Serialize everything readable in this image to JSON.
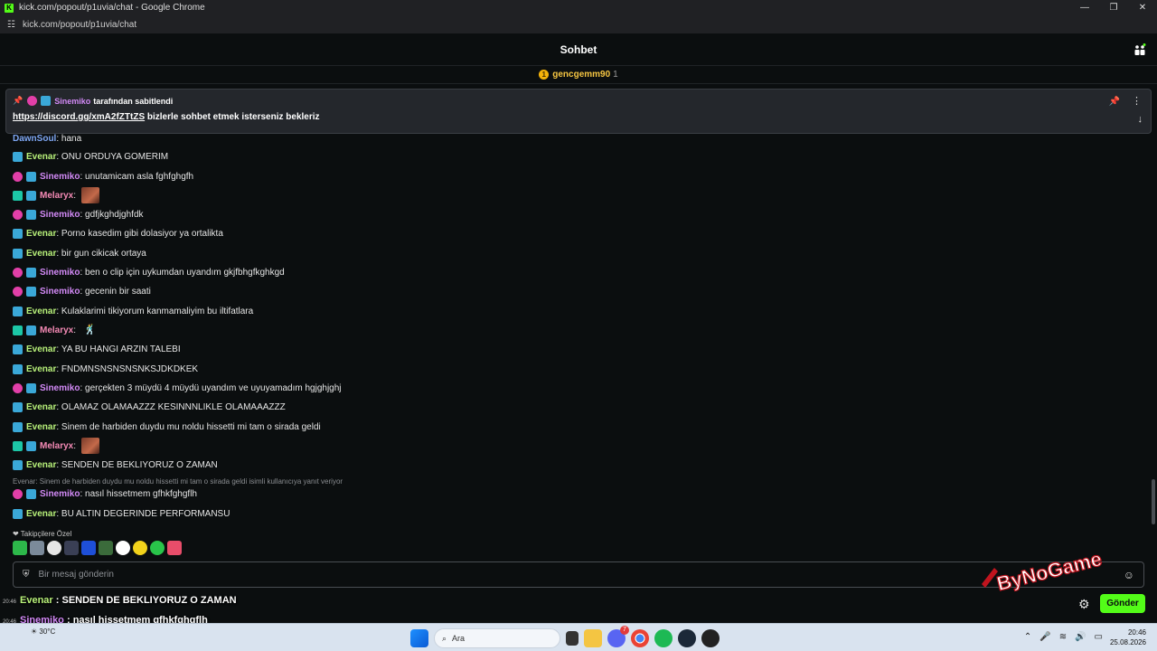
{
  "window": {
    "title": "kick.com/popout/p1uvia/chat - Google Chrome",
    "url": "kick.com/popout/p1uvia/chat",
    "controls": {
      "minimize": "—",
      "restore": "❐",
      "close": "✕"
    }
  },
  "header": {
    "title": "Sohbet"
  },
  "gifter": {
    "name": "gencgemm90",
    "count": "1",
    "coin_glyph": "1"
  },
  "pinned": {
    "by_user": "Sinemiko",
    "by_text": "tarafından sabitlendi",
    "link": "https://discord.gg/xmA2fZTtZS",
    "text": " bizlerle sohbet etmek isterseniz bekleriz"
  },
  "colors": {
    "kick_green": "#53fc18",
    "evenar": "#b8f17a",
    "sinemiko": "#d38af7",
    "melaryx": "#f58ab5",
    "dawnsoul": "#7ea6f2",
    "background": "#0b0e0f"
  },
  "messages": [
    {
      "user": "DawnSoul",
      "text": "hana",
      "badges": [],
      "color": "#7ea6f2"
    },
    {
      "user": "Evenar",
      "text": "ONU ORDUYA GOMERIM",
      "badges": [
        "vip"
      ],
      "color": "#b8f17a"
    },
    {
      "user": "Sinemiko",
      "text": "unutamicam asla fghfghgfh",
      "badges": [
        "og",
        "vip"
      ],
      "color": "#d38af7"
    },
    {
      "user": "Melaryx",
      "text": "",
      "badges": [
        "sub",
        "vip"
      ],
      "color": "#f58ab5",
      "emote": "photo-emote"
    },
    {
      "user": "Sinemiko",
      "text": "gdfjkghdjghfdk",
      "badges": [
        "og",
        "vip"
      ],
      "color": "#d38af7"
    },
    {
      "user": "Evenar",
      "text": "Porno kasedim gibi dolasiyor ya ortalikta",
      "badges": [
        "vip"
      ],
      "color": "#b8f17a"
    },
    {
      "user": "Evenar",
      "text": "bir gun cikicak ortaya",
      "badges": [
        "vip"
      ],
      "color": "#b8f17a"
    },
    {
      "user": "Sinemiko",
      "text": "ben o clip için uykumdan uyandım gkjfbhgfkghkgd",
      "badges": [
        "og",
        "vip"
      ],
      "color": "#d38af7"
    },
    {
      "user": "Sinemiko",
      "text": "gecenin bir saati",
      "badges": [
        "og",
        "vip"
      ],
      "color": "#d38af7"
    },
    {
      "user": "Evenar",
      "text": "Kulaklarimi tikiyorum kanmamaliyim bu iltifatlara",
      "badges": [
        "vip"
      ],
      "color": "#b8f17a"
    },
    {
      "user": "Melaryx",
      "text": "",
      "badges": [
        "sub",
        "vip"
      ],
      "color": "#f58ab5",
      "emote": "dancing-emote"
    },
    {
      "user": "Evenar",
      "text": "YA BU HANGI ARZIN TALEBI",
      "badges": [
        "vip"
      ],
      "color": "#b8f17a"
    },
    {
      "user": "Evenar",
      "text": "FNDMNSNSNSNSNKSJDKDKEK",
      "badges": [
        "vip"
      ],
      "color": "#b8f17a"
    },
    {
      "user": "Sinemiko",
      "text": "gerçekten 3 müydü 4 müydü uyandım ve uyuyamadım hgjghjghj",
      "badges": [
        "og",
        "vip"
      ],
      "color": "#d38af7"
    },
    {
      "user": "Evenar",
      "text": "OLAMAZ OLAMAAZZZ KESINNNLIKLE OLAMAAAZZZ",
      "badges": [
        "vip"
      ],
      "color": "#b8f17a"
    },
    {
      "user": "Evenar",
      "text": "Sinem de harbiden duydu mu noldu hissetti mi tam o sirada geldi",
      "badges": [
        "vip"
      ],
      "color": "#b8f17a"
    },
    {
      "user": "Melaryx",
      "text": "",
      "badges": [
        "sub",
        "vip"
      ],
      "color": "#f58ab5",
      "emote": "photo-emote"
    },
    {
      "user": "Evenar",
      "text": "SENDEN DE BEKLIYORUZ O ZAMAN",
      "badges": [
        "vip"
      ],
      "color": "#b8f17a"
    },
    {
      "user": "Sinemiko",
      "text": "nasıl hissetmem gfhkfghgflh",
      "badges": [
        "og",
        "vip"
      ],
      "color": "#d38af7"
    },
    {
      "user": "Evenar",
      "text": "BU ALTIN DEGERINDE PERFORMANSU",
      "badges": [
        "vip"
      ],
      "color": "#b8f17a"
    }
  ],
  "reply_note": "Evenar: Sinem de harbiden duydu mu noldu hissetti mi tam o sirada geldi isimli kullanıcıya yanıt veriyor",
  "followers_label": "Takipçilere Özel",
  "input": {
    "placeholder": "Bir mesaj gönderin"
  },
  "send_button": "Gönder",
  "watermark": "ByNoGame",
  "overlay": [
    {
      "time": "20:46",
      "user": "Evenar",
      "text": "SENDEN DE BEKLIYORUZ O ZAMAN"
    },
    {
      "time": "20:46",
      "user": "Sinemiko",
      "text": "nasıl hissetmem gfhkfghgflh"
    },
    {
      "time": "20:46",
      "user": "Evenar",
      "text": "BU ALTIN DEGERINDE PERFORMANSU"
    }
  ],
  "taskbar": {
    "weather": "30°C",
    "search_placeholder": "Ara",
    "time": "20:46",
    "date": "25.08.2026",
    "discord_badge": "7"
  }
}
